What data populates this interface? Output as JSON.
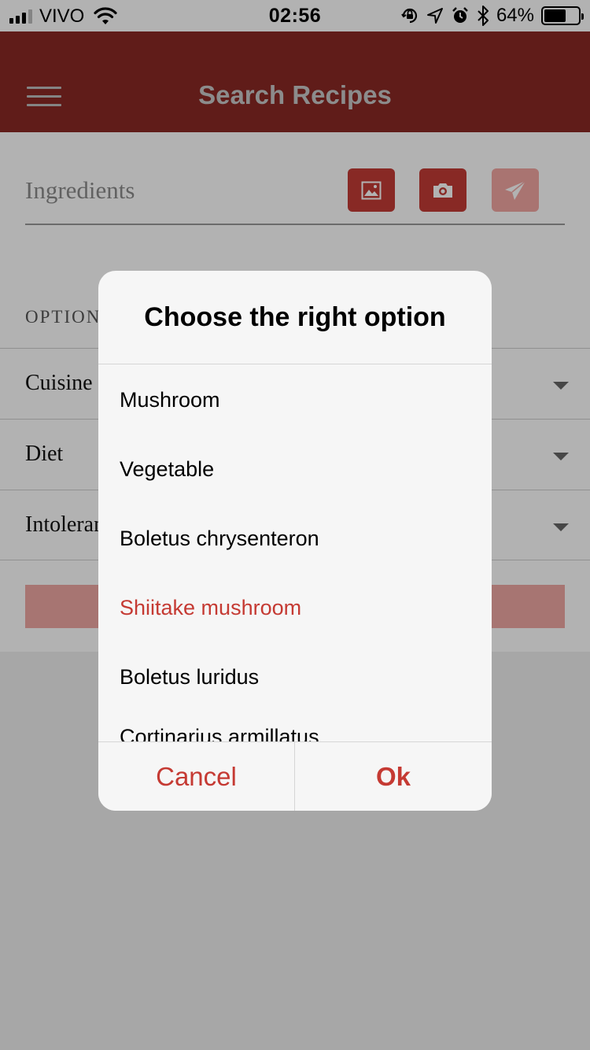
{
  "status_bar": {
    "carrier": "VIVO",
    "time": "02:56",
    "battery_percent": "64%",
    "battery_level": 0.64,
    "signal_bars_active": 3,
    "icons": [
      "wifi-icon",
      "orientation-lock-icon",
      "location-arrow-icon",
      "alarm-icon",
      "bluetooth-icon",
      "battery-icon"
    ]
  },
  "app_bar": {
    "title": "Search Recipes",
    "menu_icon": "hamburger-menu-icon",
    "background": "#8a2925"
  },
  "search": {
    "ingredients_placeholder": "Ingredients",
    "buttons": [
      {
        "icon": "image-icon",
        "enabled": true
      },
      {
        "icon": "camera-icon",
        "enabled": true
      },
      {
        "icon": "send-icon",
        "enabled": false
      }
    ]
  },
  "options": {
    "section_label": "OPTIONS",
    "rows": [
      {
        "label": "Cuisine"
      },
      {
        "label": "Diet"
      },
      {
        "label": "Intolerances"
      }
    ]
  },
  "dialog": {
    "title": "Choose the right option",
    "items": [
      {
        "label": "Mushroom",
        "selected": false
      },
      {
        "label": "Vegetable",
        "selected": false
      },
      {
        "label": "Boletus chrysenteron",
        "selected": false
      },
      {
        "label": "Shiitake mushroom",
        "selected": true
      },
      {
        "label": "Boletus luridus",
        "selected": false
      },
      {
        "label": "Cortinarius armillatus",
        "selected": false
      }
    ],
    "cancel_label": "Cancel",
    "ok_label": "Ok",
    "accent_color": "#c53a33"
  }
}
